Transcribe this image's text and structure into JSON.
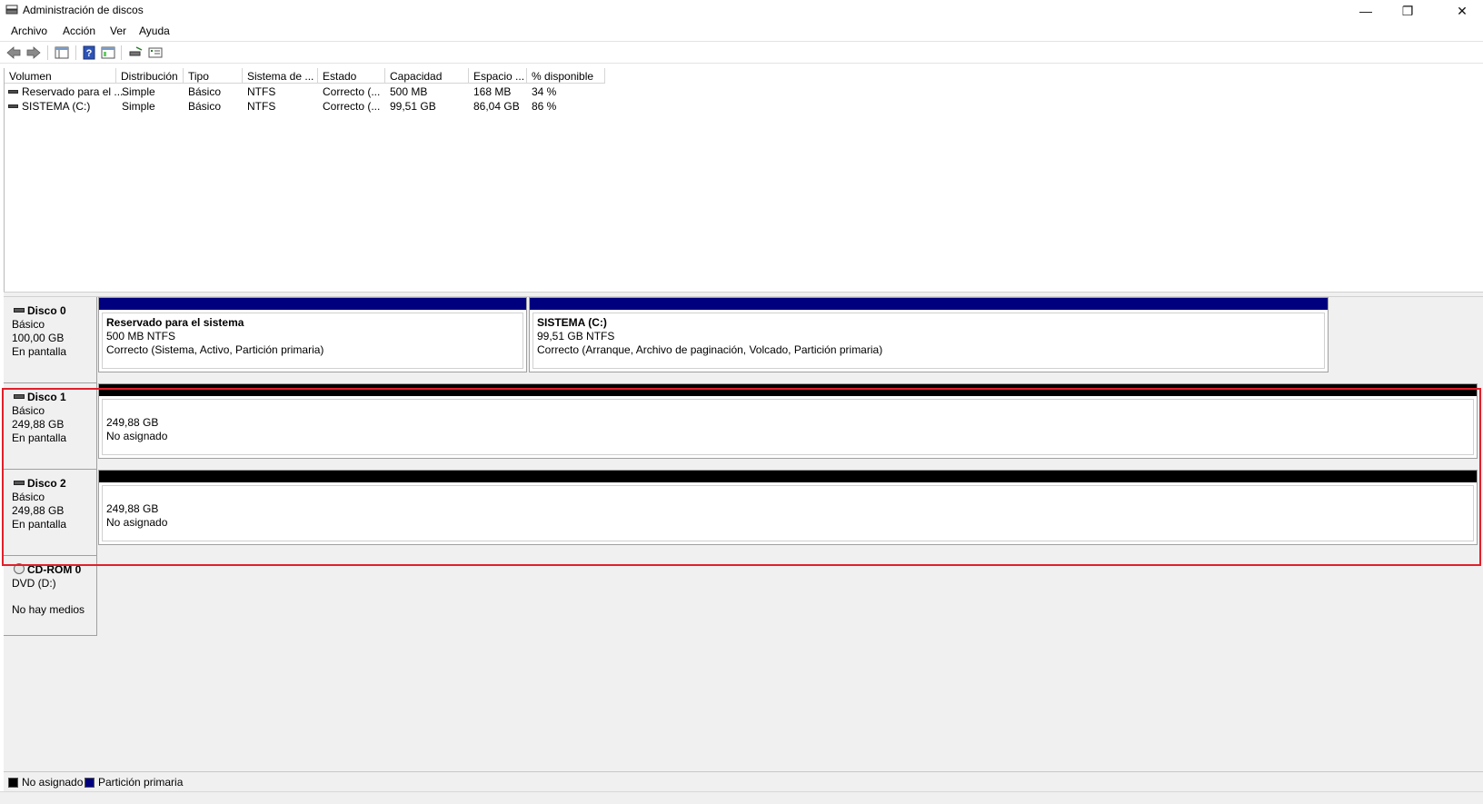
{
  "window": {
    "title": "Administración de discos",
    "minimize_glyph": "—",
    "maximize_glyph": "❐",
    "close_glyph": "✕"
  },
  "menu": {
    "items": [
      "Archivo",
      "Acción",
      "Ver",
      "Ayuda"
    ]
  },
  "toolbar": {
    "buttons": [
      "back-arrow-icon",
      "forward-arrow-icon",
      "console-tree-icon",
      "help-icon",
      "properties-icon",
      "rescan-icon",
      "settings-icon"
    ]
  },
  "volume_list": {
    "columns": [
      "Volumen",
      "Distribución",
      "Tipo",
      "Sistema de ...",
      "Estado",
      "Capacidad",
      "Espacio ...",
      "% disponible"
    ],
    "rows": [
      {
        "volume": "Reservado para el ...",
        "layout": "Simple",
        "type": "Básico",
        "fs": "NTFS",
        "status": "Correcto (...",
        "capacity": "500 MB",
        "free": "168 MB",
        "pct": "34 %"
      },
      {
        "volume": "SISTEMA (C:)",
        "layout": "Simple",
        "type": "Básico",
        "fs": "NTFS",
        "status": "Correcto (...",
        "capacity": "99,51 GB",
        "free": "86,04 GB",
        "pct": "86 %"
      }
    ]
  },
  "disks": [
    {
      "name": "Disco 0",
      "kind": "Básico",
      "size": "100,00 GB",
      "state": "En pantalla",
      "partitions": [
        {
          "title": "Reservado para el sistema",
          "size": "500 MB NTFS",
          "status": "Correcto (Sistema, Activo, Partición primaria)"
        },
        {
          "title": "SISTEMA  (C:)",
          "size": "99,51 GB NTFS",
          "status": "Correcto (Arranque, Archivo de paginación, Volcado, Partición primaria)"
        }
      ]
    },
    {
      "name": "Disco 1",
      "kind": "Básico",
      "size": "249,88 GB",
      "state": "En pantalla",
      "partitions": [
        {
          "size": "249,88 GB",
          "status": "No asignado"
        }
      ]
    },
    {
      "name": "Disco 2",
      "kind": "Básico",
      "size": "249,88 GB",
      "state": "En pantalla",
      "partitions": [
        {
          "size": "249,88 GB",
          "status": "No asignado"
        }
      ]
    }
  ],
  "cdrom": {
    "name": "CD-ROM 0",
    "drive": "DVD (D:)",
    "state": "No hay medios"
  },
  "legend": [
    {
      "label": "No asignado",
      "color": "#000000"
    },
    {
      "label": "Partición primaria",
      "color": "#00007f"
    }
  ],
  "colors": {
    "primary_partition": "#00007f",
    "unallocated": "#000000",
    "highlight": "#e0202a"
  }
}
